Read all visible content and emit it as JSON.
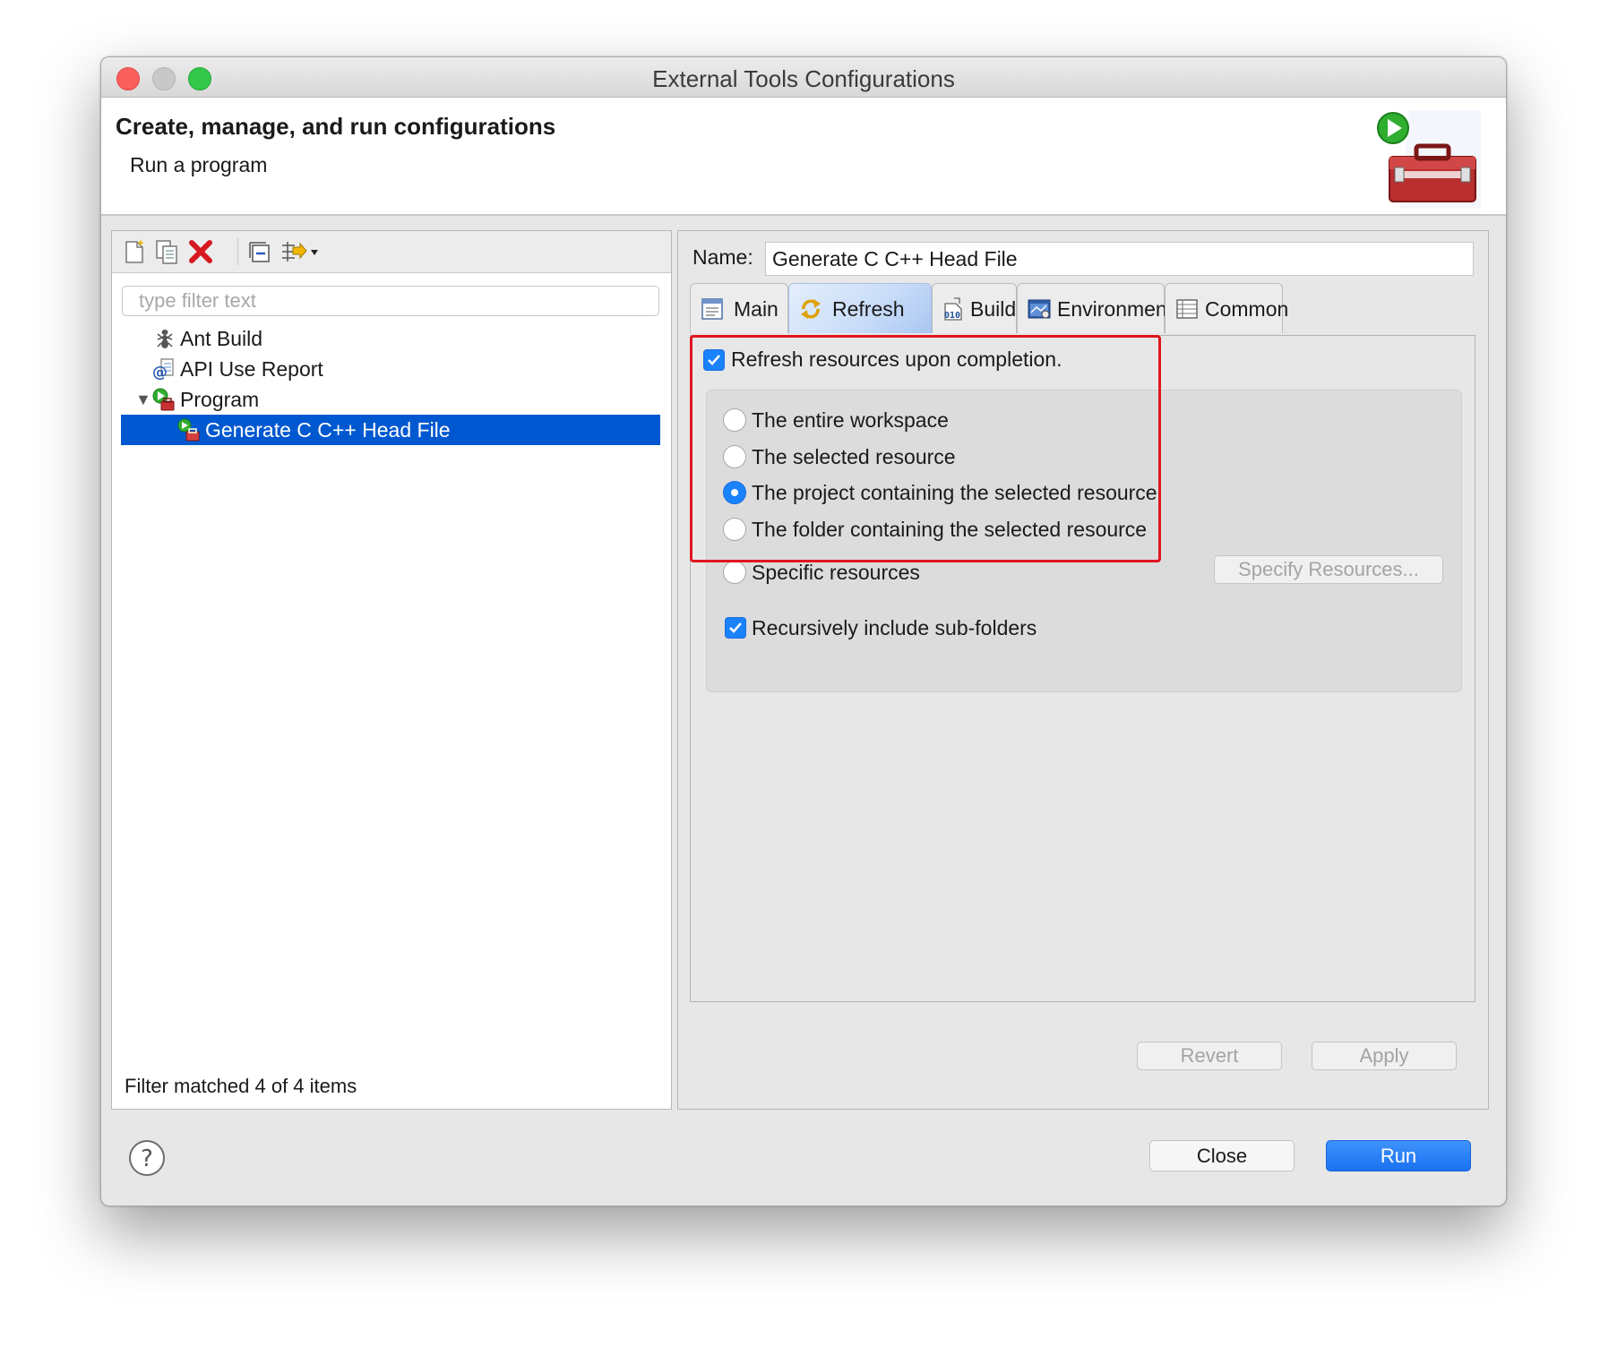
{
  "window": {
    "title": "External Tools Configurations"
  },
  "banner": {
    "title": "Create, manage, and run configurations",
    "subtitle": "Run a program",
    "icon": "toolbox-run-icon"
  },
  "left_toolbar": {
    "icons": [
      "new-config-icon",
      "duplicate-icon",
      "delete-icon",
      "collapse-all-icon",
      "filter-menu-icon"
    ]
  },
  "filter": {
    "placeholder": "type filter text",
    "value": ""
  },
  "tree": {
    "items": [
      {
        "label": "Ant Build",
        "icon": "ant-icon",
        "expanded": false
      },
      {
        "label": "API Use Report",
        "icon": "api-report-icon",
        "expanded": false
      },
      {
        "label": "Program",
        "icon": "program-icon",
        "expanded": true
      },
      {
        "label": "Generate C C++ Head File",
        "icon": "program-config-icon",
        "selected": true
      }
    ],
    "status": "Filter matched 4 of 4 items"
  },
  "config": {
    "name_label": "Name:",
    "name_value": "Generate C C++ Head File"
  },
  "tabs": [
    {
      "label": "Main",
      "icon": "main-tab-icon",
      "active": false
    },
    {
      "label": "Refresh",
      "icon": "refresh-icon",
      "active": true
    },
    {
      "label": "Build",
      "icon": "build-icon",
      "active": false
    },
    {
      "label": "Environment",
      "icon": "environment-icon",
      "active": false
    },
    {
      "label": "Common",
      "icon": "common-icon",
      "active": false
    }
  ],
  "refresh": {
    "refresh_on_completion": {
      "label": "Refresh resources upon completion.",
      "checked": true
    },
    "options": [
      {
        "label": "The entire workspace",
        "selected": false
      },
      {
        "label": "The selected resource",
        "selected": false
      },
      {
        "label": "The project containing the selected resource",
        "selected": true
      },
      {
        "label": "The folder containing the selected resource",
        "selected": false
      },
      {
        "label": "Specific resources",
        "selected": false
      }
    ],
    "specify_button": "Specify Resources...",
    "recursive": {
      "label": "Recursively include sub-folders",
      "checked": true
    }
  },
  "buttons": {
    "revert": "Revert",
    "apply": "Apply",
    "close": "Close",
    "run": "Run"
  },
  "colors": {
    "accent": "#1a82fb",
    "selection": "#0058d0",
    "highlight_box": "#e0161e"
  }
}
